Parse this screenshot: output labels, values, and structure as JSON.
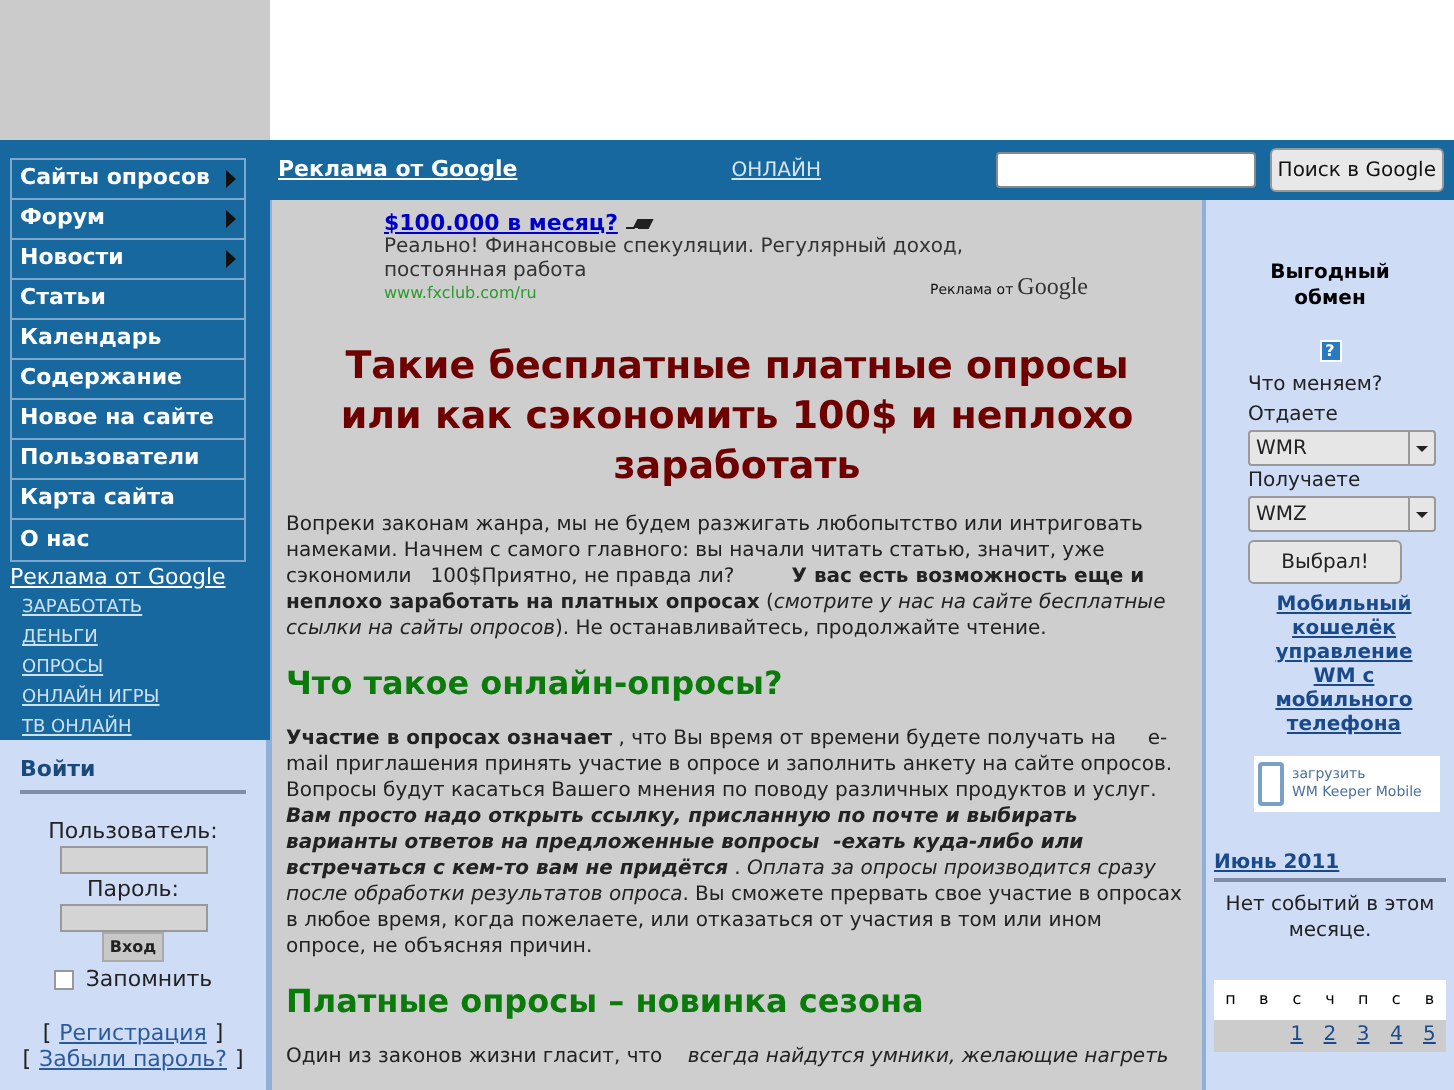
{
  "top_bar": {
    "ads_label": "Реклама от Google",
    "online_link": "ОНЛАЙН",
    "search_button": "Поиск в Google"
  },
  "nav": [
    {
      "label": "Сайты опросов",
      "submenu": true
    },
    {
      "label": "Форум",
      "submenu": true
    },
    {
      "label": "Новости",
      "submenu": true
    },
    {
      "label": "Статьи",
      "submenu": false
    },
    {
      "label": "Календарь",
      "submenu": false
    },
    {
      "label": "Содержание",
      "submenu": false
    },
    {
      "label": "Новое на сайте",
      "submenu": false
    },
    {
      "label": "Пользователи",
      "submenu": false
    },
    {
      "label": "Карта сайта",
      "submenu": false
    },
    {
      "label": "О нас",
      "submenu": false
    }
  ],
  "side_ads": {
    "title": "Реклама от Google",
    "links": [
      "ЗАРАБОТАТЬ",
      "ДЕНЬГИ",
      "ОПРОСЫ",
      "ОНЛАЙН ИГРЫ",
      "ТВ ОНЛАЙН"
    ]
  },
  "login": {
    "title": "Войти",
    "user_label": "Пользователь:",
    "password_label": "Пароль:",
    "submit": "Вход",
    "remember": {
      "label": "Запомнить",
      "checked": false
    },
    "register": "Регистрация",
    "forgot": "Забыли пароль?",
    "bracket_open": "[",
    "bracket_close": "]"
  },
  "ad": {
    "headline": "$100.000 в месяц?",
    "text": "Реально! Финансовые спекуляции. Регулярный доход, постоянная работа",
    "url": "www.fxclub.com/ru",
    "label": "Реклама от",
    "brand": "Google"
  },
  "article": {
    "title": "Такие бесплатные платные опросы или как сэкономить 100$ и неплохо заработать",
    "blocks": [
      {
        "kind": "p",
        "text": "Вопреки законам жанра, мы не будем разжигать любопытство или интриговать намеками. Начнем с самого главного: вы начали читать статью, значит, уже сэкономили   100$Приятно, не правда ли?         **У вас есть возможность еще и неплохо заработать на платных опросах** (*смотрите у нас на сайте бесплатные ссылки на сайты опросов*). Не останавливайтесь, продолжайте чтение."
      },
      {
        "kind": "h2",
        "text": "Что такое онлайн-опросы?"
      },
      {
        "kind": "p",
        "text": "**Участие в опросах означает** , что Вы время от времени будете получать на     e-mail приглашения принять участие в опросе и заполнить анкету на сайте опросов. Вопросы будут касаться Вашего мнения по поводу различных продуктов и услуг. ",
        "emphasis": "Вам просто надо открыть ссылку, присланную по почте и выбирать варианты ответов на предложенные вопросы  -ехать куда-либо или встречаться с кем-то вам не придётся",
        "text_after": " . *Оплата за опросы производится сразу после обработки результатов опроса*. Вы сможете прервать свое участие в опросах в любое время, когда пожелаете, или отказаться от участия в том или ином опросе, не объясняя причин."
      },
      {
        "kind": "h2",
        "text": "Платные опросы – новинка сезона"
      },
      {
        "kind": "p",
        "text": "Один из законов жизни гласит, что    *всегда найдутся умники, желающие нагреть*"
      }
    ]
  },
  "exchange": {
    "title": "Выгодный обмен",
    "help": "?",
    "question": "Что меняем?",
    "give_label": "Отдаете",
    "give": "WMR",
    "get_label": "Получаете",
    "get": "WMZ",
    "button": "Выбрал!",
    "mobile_link": "Мобильный кошелёк управление WM с мобильного телефона",
    "banner_line_1": "загрузить",
    "banner_line_2": "WM Keeper Mobile"
  },
  "calendar": {
    "month": "Июнь 2011",
    "no_events": "Нет событий в этом месяце.",
    "weekdays": [
      "п",
      "в",
      "с",
      "ч",
      "п",
      "с",
      "в"
    ],
    "first_row": [
      "1",
      "2",
      "3",
      "4",
      "5"
    ]
  }
}
